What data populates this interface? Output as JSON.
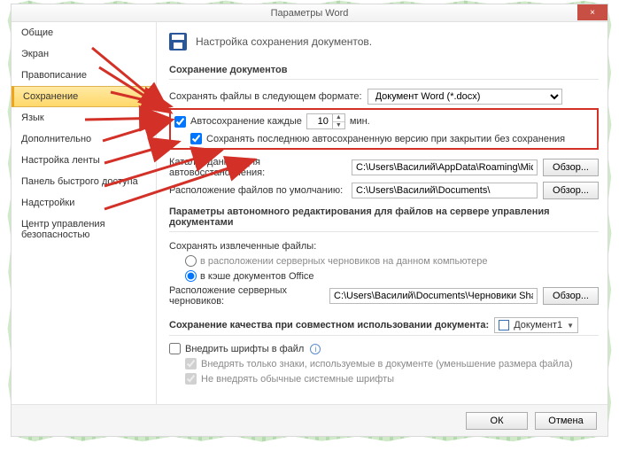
{
  "window": {
    "title": "Параметры Word",
    "close": "×"
  },
  "sidebar": {
    "items": [
      {
        "label": "Общие"
      },
      {
        "label": "Экран"
      },
      {
        "label": "Правописание"
      },
      {
        "label": "Сохранение",
        "selected": true
      },
      {
        "label": "Язык"
      },
      {
        "label": "Дополнительно"
      },
      {
        "label": "Настройка ленты"
      },
      {
        "label": "Панель быстрого доступа"
      },
      {
        "label": "Надстройки"
      },
      {
        "label": "Центр управления безопасностью"
      }
    ]
  },
  "header": {
    "text": "Настройка сохранения документов."
  },
  "save_section": {
    "title": "Сохранение документов",
    "format_label": "Сохранять файлы в следующем формате:",
    "format_value": "Документ Word (*.docx)",
    "autosave_label": "Автосохранение каждые",
    "autosave_value": "10",
    "autosave_unit": "мин.",
    "keep_last_label": "Сохранять последнюю автосохраненную версию при закрытии без сохранения",
    "autorecover_label": "Каталог данных для автовосстановления:",
    "autorecover_value": "C:\\Users\\Василий\\AppData\\Roaming\\Microsoft\\Word\\",
    "default_loc_label": "Расположение файлов по умолчанию:",
    "default_loc_value": "C:\\Users\\Василий\\Documents\\",
    "browse": "Обзор..."
  },
  "offline_section": {
    "title": "Параметры автономного редактирования для файлов на сервере управления документами",
    "keep_label": "Сохранять извлеченные файлы:",
    "opt_server": "в расположении серверных черновиков на данном компьютере",
    "opt_cache": "в кэше документов Office",
    "drafts_label": "Расположение серверных черновиков:",
    "drafts_value": "C:\\Users\\Василий\\Documents\\Черновики SharePoint\\",
    "browse": "Обзор..."
  },
  "quality_section": {
    "title": "Сохранение качества при совместном использовании документа:",
    "doc_name": "Документ1",
    "embed_label": "Внедрить шрифты в файл",
    "only_used": "Внедрять только знаки, используемые в документе (уменьшение размера файла)",
    "no_system": "Не внедрять обычные системные шрифты"
  },
  "footer": {
    "ok": "ОК",
    "cancel": "Отмена"
  }
}
